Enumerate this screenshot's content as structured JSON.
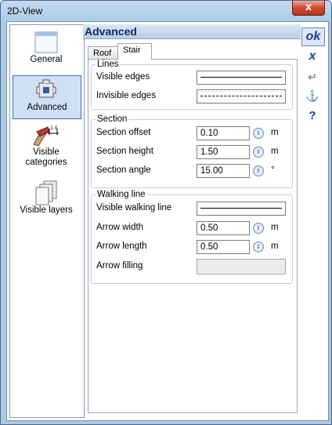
{
  "window": {
    "title": "2D-View",
    "close_label": "x"
  },
  "sidebar": {
    "items": [
      {
        "label": "General",
        "icon": "window-icon"
      },
      {
        "label": "Advanced",
        "icon": "advanced-icon"
      },
      {
        "label": "Visible categories",
        "icon": "categories-icon"
      },
      {
        "label": "Visible layers",
        "icon": "layers-icon"
      }
    ],
    "selected": "Advanced"
  },
  "panel": {
    "title": "Advanced",
    "tabs": [
      {
        "label": "Roof"
      },
      {
        "label": "Stair"
      }
    ],
    "active_tab": "Stair",
    "groups": {
      "lines": {
        "title": "Lines",
        "visible_edges_label": "Visible edges",
        "invisible_edges_label": "Invisible edges"
      },
      "section": {
        "title": "Section",
        "offset_label": "Section offset",
        "offset_value": "0.10",
        "offset_unit": "m",
        "height_label": "Section height",
        "height_value": "1.50",
        "height_unit": "m",
        "angle_label": "Section angle",
        "angle_value": "15.00",
        "angle_unit": "°"
      },
      "walking": {
        "title": "Walking line",
        "visible_label": "Visible walking line",
        "arrow_width_label": "Arrow width",
        "arrow_width_value": "0.50",
        "arrow_width_unit": "m",
        "arrow_length_label": "Arrow length",
        "arrow_length_value": "0.50",
        "arrow_length_unit": "m",
        "arrow_filling_label": "Arrow filling"
      }
    }
  },
  "toolbar": {
    "ok_label": "ok",
    "cancel_label": "x",
    "apply_label": "↵",
    "anchor_label": "⚓",
    "help_label": "?"
  },
  "colors": {
    "header_text": "#0d2a66",
    "toolbar_icon": "#1f3f8f",
    "close_red": "#cf4a31"
  }
}
